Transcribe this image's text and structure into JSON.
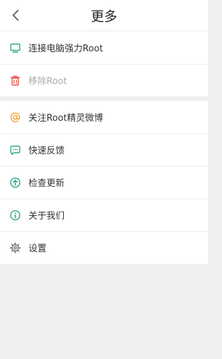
{
  "header": {
    "title": "更多",
    "back_icon": "chevron-left-icon"
  },
  "colors": {
    "green": "#2aa58a",
    "red": "#e0524a",
    "orange": "#f0a035",
    "teal": "#22a38a",
    "gray": "#666666"
  },
  "group1": {
    "items": [
      {
        "label": "连接电脑强力Root",
        "icon": "monitor-icon"
      },
      {
        "label": "移除Root",
        "icon": "trash-icon",
        "disabled": true
      }
    ]
  },
  "group2": {
    "items": [
      {
        "label": "关注Root精灵微博",
        "icon": "at-sign-icon"
      },
      {
        "label": "快速反馈",
        "icon": "chat-bubble-icon"
      },
      {
        "label": "检查更新",
        "icon": "upload-arrow-icon"
      },
      {
        "label": "关于我们",
        "icon": "info-icon"
      },
      {
        "label": "设置",
        "icon": "gear-icon"
      }
    ]
  }
}
